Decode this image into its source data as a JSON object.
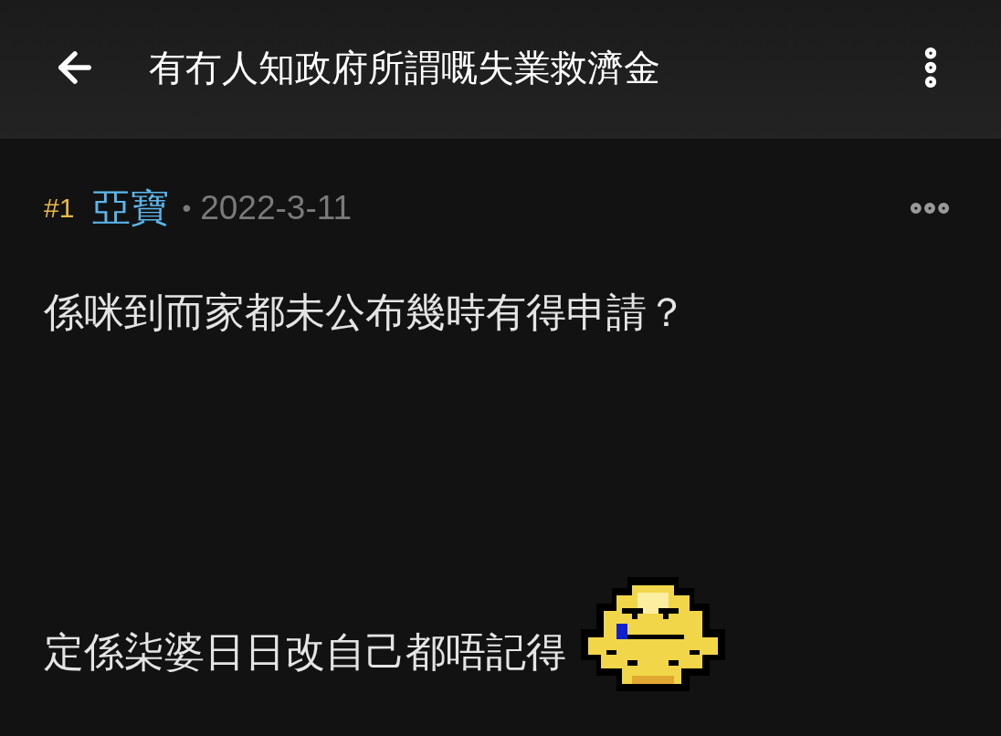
{
  "header": {
    "title": "有冇人知政府所謂嘅失業救濟金"
  },
  "post": {
    "number": "#1",
    "author": "亞寶",
    "separator": "•",
    "date": "2022-3-11",
    "blocks": [
      {
        "kind": "text",
        "text": "係咪到而家都未公布幾時有得申請？"
      },
      {
        "kind": "text_with_sticker",
        "text": "定係柒婆日日改自己都唔記得"
      }
    ]
  }
}
